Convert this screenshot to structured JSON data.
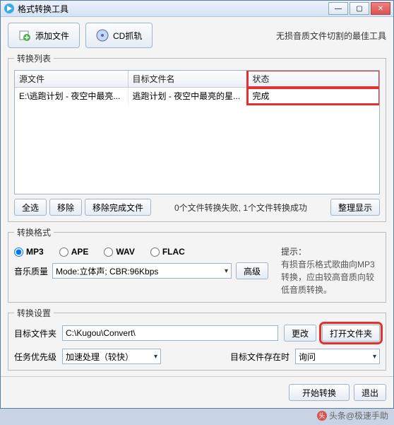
{
  "window": {
    "title": "格式转换工具"
  },
  "toolbar": {
    "add_file": "添加文件",
    "cd_rip": "CD抓轨",
    "tagline": "无损音质文件切割的最佳工具"
  },
  "list": {
    "legend": "转换列表",
    "cols": {
      "src": "源文件",
      "dst": "目标文件名",
      "status": "状态"
    },
    "rows": [
      {
        "src": "E:\\逃跑计划 - 夜空中最亮...",
        "dst": "逃跑计划 - 夜空中最亮的星...",
        "status": "完成"
      }
    ],
    "footer": {
      "select_all": "全选",
      "remove": "移除",
      "remove_done": "移除完成文件",
      "status": "0个文件转换失败, 1个文件转换成功",
      "arrange": "整理显示"
    }
  },
  "format": {
    "legend": "转换格式",
    "options": [
      "MP3",
      "APE",
      "WAV",
      "FLAC"
    ],
    "selected": "MP3",
    "quality_label": "音乐质量",
    "quality_value": "Mode:立体声; CBR:96Kbps",
    "advanced": "高级",
    "hint_title": "提示：",
    "hint_body": "有损音乐格式歌曲向MP3转换，应由较高音质向较低音质转换。"
  },
  "settings": {
    "legend": "转换设置",
    "folder_label": "目标文件夹",
    "folder_value": "C:\\Kugou\\Convert\\",
    "change": "更改",
    "open_folder": "打开文件夹",
    "priority_label": "任务优先级",
    "priority_value": "加速处理（较快）",
    "exists_label": "目标文件存在时",
    "exists_value": "询问"
  },
  "bottom": {
    "start": "开始转换",
    "exit": "退出"
  },
  "watermark": "头条@极速手助"
}
